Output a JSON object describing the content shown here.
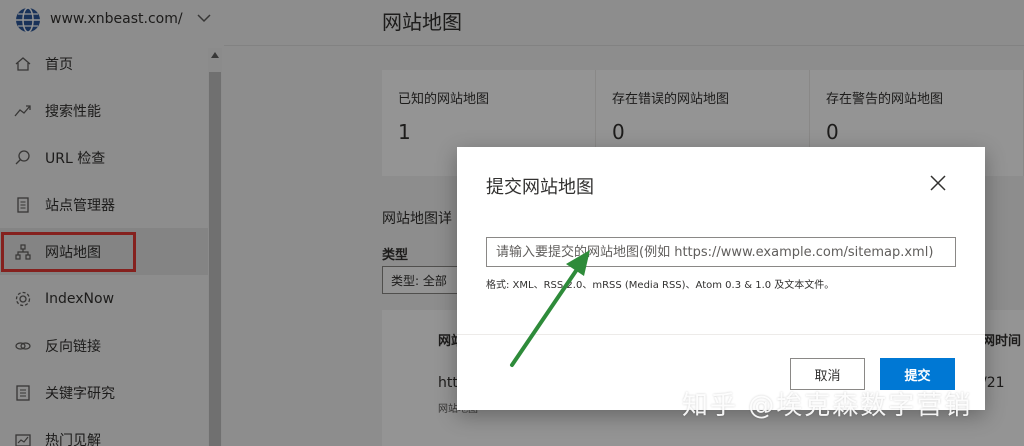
{
  "site": {
    "url": "www.xnbeast.com/"
  },
  "sidebar": {
    "items": [
      {
        "label": "首页",
        "icon": "home-icon"
      },
      {
        "label": "搜索性能",
        "icon": "trend-icon"
      },
      {
        "label": "URL 检查",
        "icon": "search-icon"
      },
      {
        "label": "站点管理器",
        "icon": "document-icon"
      },
      {
        "label": "网站地图",
        "icon": "sitemap-icon",
        "selected": true
      },
      {
        "label": "IndexNow",
        "icon": "gear-icon"
      },
      {
        "label": "反向链接",
        "icon": "link-icon"
      },
      {
        "label": "关键字研究",
        "icon": "list-icon"
      },
      {
        "label": "热门见解",
        "icon": "insight-icon"
      }
    ]
  },
  "page": {
    "title": "网站地图",
    "stats": [
      {
        "label": "已知的网站地图",
        "value": "1"
      },
      {
        "label": "存在错误的网站地图",
        "value": "0"
      },
      {
        "label": "存在警告的网站地图",
        "value": "0"
      }
    ],
    "details_title": "网站地图详",
    "type_label": "类型",
    "type_select": "类型: 全部",
    "table": {
      "col1": "网站",
      "col2": "网时间",
      "row_url": "htt",
      "row_sub": "网站地图",
      "row_date": "/21"
    }
  },
  "dialog": {
    "title": "提交网站地图",
    "input_placeholder": "请输入要提交的网站地图(例如 https://www.example.com/sitemap.xml)",
    "format_hint": "格式: XML、RSS 2.0、mRSS (Media RSS)、Atom 0.3 & 1.0 及文本文件。",
    "cancel_label": "取消",
    "submit_label": "提交"
  },
  "watermark": "知乎 @埃克森数字营销",
  "colors": {
    "accent": "#0078d4",
    "highlight": "#e53935",
    "arrow": "#2e8b3a"
  }
}
